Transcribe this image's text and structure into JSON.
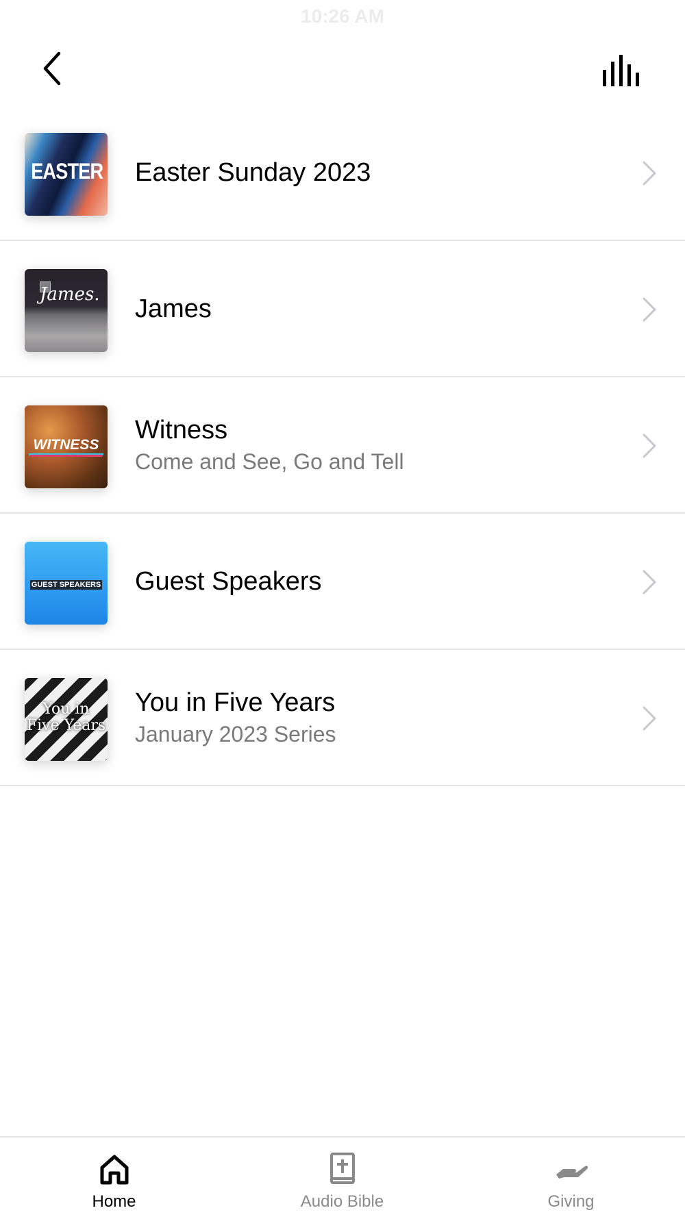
{
  "status_bar": {
    "time": "10:26 AM"
  },
  "header": {
    "back_icon": "chevron-left-icon",
    "audio_icon": "audio-bars-icon"
  },
  "series": [
    {
      "title": "Easter Sunday 2023",
      "subtitle": "",
      "thumbnail_text": "EASTER"
    },
    {
      "title": "James",
      "subtitle": "",
      "thumbnail_text": "James."
    },
    {
      "title": "Witness",
      "subtitle": "Come and See, Go and Tell",
      "thumbnail_text": "WITNESS"
    },
    {
      "title": "Guest Speakers",
      "subtitle": "",
      "thumbnail_text": "GUEST SPEAKERS"
    },
    {
      "title": "You in Five Years",
      "subtitle": "January 2023 Series",
      "thumbnail_text": "You in Five Years"
    }
  ],
  "tabbar": {
    "tabs": [
      {
        "label": "Home",
        "icon": "home-icon",
        "active": true
      },
      {
        "label": "Audio Bible",
        "icon": "bible-icon",
        "active": false
      },
      {
        "label": "Giving",
        "icon": "giving-hand-icon",
        "active": false
      }
    ]
  },
  "colors": {
    "text_primary": "#000000",
    "text_secondary": "#7a7a7a",
    "tab_inactive": "#8a8a8a",
    "divider": "#e6e6e6"
  }
}
